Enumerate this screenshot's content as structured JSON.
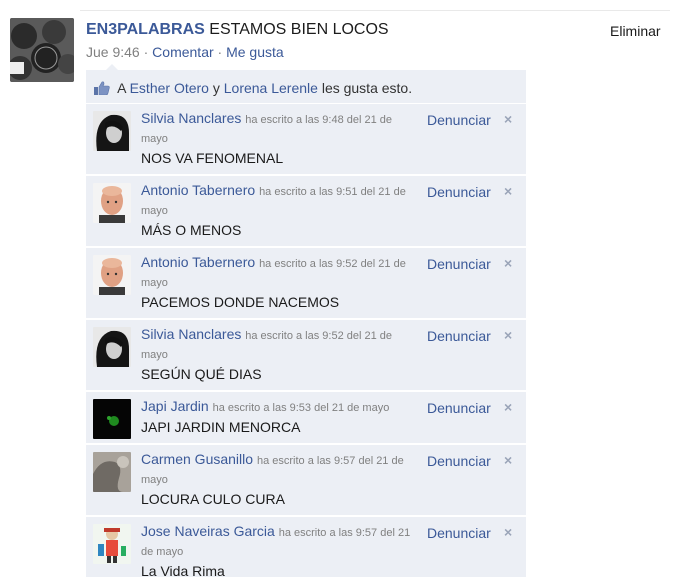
{
  "story": {
    "author": "EN3PALABRAS",
    "text": "ESTAMOS BIEN LOCOS",
    "time": "Jue 9:46",
    "sep": " · ",
    "comment_link": "Comentar",
    "like_link": "Me gusta",
    "delete_label": "Eliminar"
  },
  "likes": {
    "prefix": "A",
    "user1": "Esther Otero",
    "conj": "y",
    "user2": "Lorena Lerenle",
    "suffix": "les gusta esto."
  },
  "comments": [
    {
      "name": "Silvia Nanclares",
      "time": "ha escrito a las 9:48 del 21 de mayo",
      "text": "NOS VA FENOMENAL",
      "report": "Denunciar",
      "close": "×",
      "avatar": "silvia"
    },
    {
      "name": "Antonio Tabernero",
      "time": "ha escrito a las 9:51 del 21 de mayo",
      "text": "MÁS O MENOS",
      "report": "Denunciar",
      "close": "×",
      "avatar": "antonio"
    },
    {
      "name": "Antonio Tabernero",
      "time": "ha escrito a las 9:52 del 21 de mayo",
      "text": "PACEMOS DONDE NACEMOS",
      "report": "Denunciar",
      "close": "×",
      "avatar": "antonio"
    },
    {
      "name": "Silvia Nanclares",
      "time": "ha escrito a las 9:52 del 21 de mayo",
      "text": "SEGÚN QUÉ DIAS",
      "report": "Denunciar",
      "close": "×",
      "avatar": "silvia"
    },
    {
      "name": "Japi Jardin",
      "time": "ha escrito a las 9:53 del 21 de mayo",
      "text": "JAPI JARDIN MENORCA",
      "report": "Denunciar",
      "close": "×",
      "avatar": "japi"
    },
    {
      "name": "Carmen Gusanillo",
      "time": "ha escrito a las 9:57 del 21 de mayo",
      "text": "LOCURA CULO CURA",
      "report": "Denunciar",
      "close": "×",
      "avatar": "carmen"
    },
    {
      "name": "Jose Naveiras Garcia",
      "time": "ha escrito a las 9:57 del 21 de mayo",
      "text": "La Vida Rima",
      "report": "Denunciar",
      "close": "×",
      "avatar": "jose"
    }
  ],
  "colors": {
    "link": "#3b5998",
    "feedback_bg": "#eceff5",
    "muted": "#808080"
  }
}
